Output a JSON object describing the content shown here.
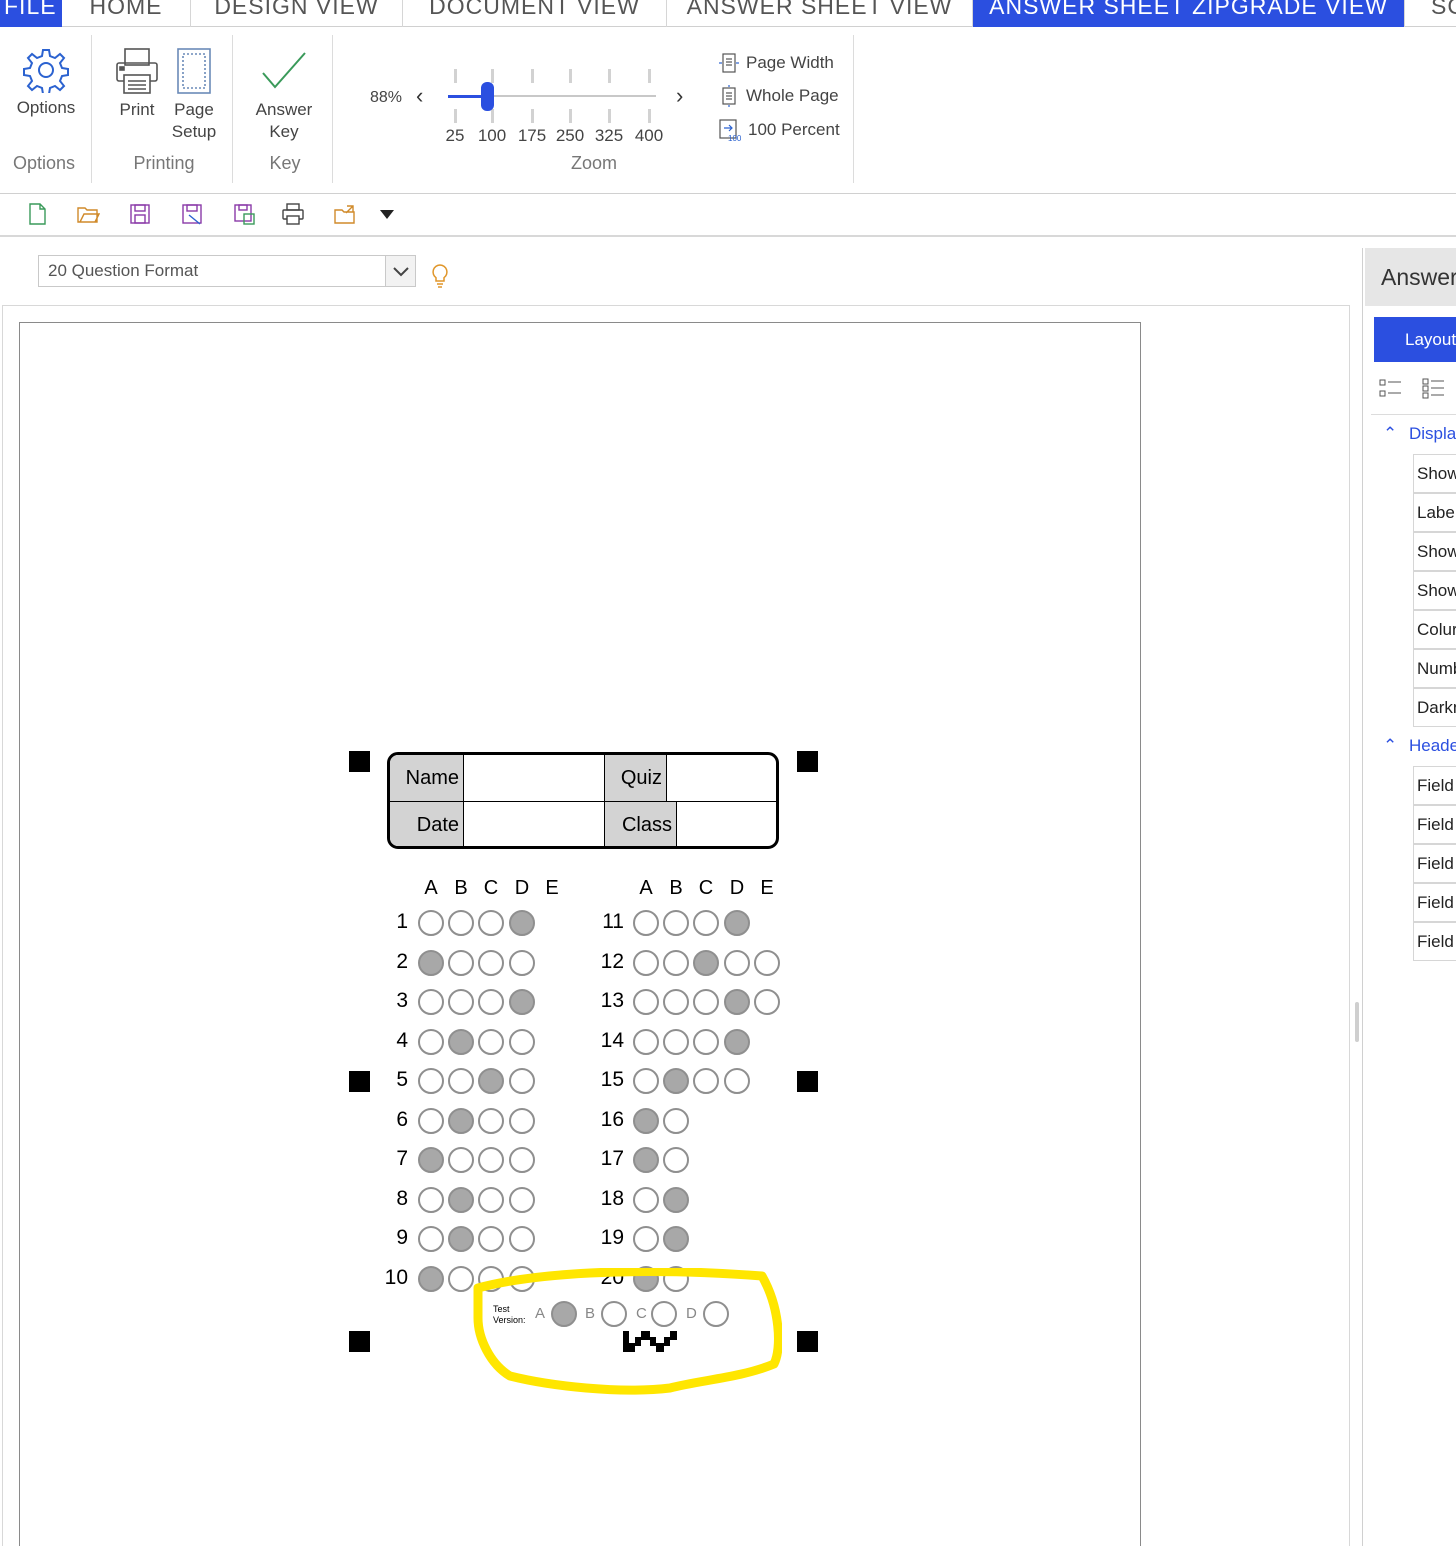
{
  "tabs": [
    {
      "label": "FILE",
      "active": false
    },
    {
      "label": "HOME",
      "active": false
    },
    {
      "label": "DESIGN VIEW",
      "active": false
    },
    {
      "label": "DOCUMENT VIEW",
      "active": false
    },
    {
      "label": "ANSWER SHEET VIEW",
      "active": false
    },
    {
      "label": "ANSWER SHEET ZIPGRADE VIEW",
      "active": true
    },
    {
      "label": "SC",
      "active": false
    }
  ],
  "ribbon": {
    "options_button": "Options",
    "options_group": "Options",
    "print_button": "Print",
    "page_setup_line1": "Page",
    "page_setup_line2": "Setup",
    "printing_group": "Printing",
    "answer_key_line1": "Answer",
    "answer_key_line2": "Key",
    "key_group": "Key",
    "zoom_group": "Zoom",
    "zoom_percent": "88%",
    "zoom_level": 88,
    "zoom_ticks": [
      "25",
      "100",
      "175",
      "250",
      "325",
      "400"
    ],
    "page_width": "Page Width",
    "whole_page": "Whole Page",
    "hundred_percent": "100 Percent",
    "hundred_icon_text": "100"
  },
  "format_select": {
    "value": "20 Question Format"
  },
  "sheet": {
    "header": {
      "name": "Name",
      "quiz": "Quiz",
      "date": "Date",
      "class": "Class"
    },
    "columns": [
      "A",
      "B",
      "C",
      "D",
      "E"
    ],
    "questions": [
      {
        "num": "1",
        "count": 4,
        "filled": 3
      },
      {
        "num": "2",
        "count": 4,
        "filled": 0
      },
      {
        "num": "3",
        "count": 4,
        "filled": 3
      },
      {
        "num": "4",
        "count": 4,
        "filled": 1
      },
      {
        "num": "5",
        "count": 4,
        "filled": 2
      },
      {
        "num": "6",
        "count": 4,
        "filled": 1
      },
      {
        "num": "7",
        "count": 4,
        "filled": 0
      },
      {
        "num": "8",
        "count": 4,
        "filled": 1
      },
      {
        "num": "9",
        "count": 4,
        "filled": 1
      },
      {
        "num": "10",
        "count": 4,
        "filled": 0
      },
      {
        "num": "11",
        "count": 4,
        "filled": 3
      },
      {
        "num": "12",
        "count": 5,
        "filled": 2
      },
      {
        "num": "13",
        "count": 5,
        "filled": 3
      },
      {
        "num": "14",
        "count": 4,
        "filled": 3
      },
      {
        "num": "15",
        "count": 4,
        "filled": 1
      },
      {
        "num": "16",
        "count": 2,
        "filled": 0
      },
      {
        "num": "17",
        "count": 2,
        "filled": 0
      },
      {
        "num": "18",
        "count": 2,
        "filled": 1
      },
      {
        "num": "19",
        "count": 2,
        "filled": 1
      },
      {
        "num": "20",
        "count": 2,
        "filled": 0
      }
    ],
    "test_version": {
      "label_line1": "Test",
      "label_line2": "Version:",
      "options": [
        "A",
        "B",
        "C",
        "D"
      ],
      "filled": 0
    },
    "highlight_color": "#ffe600",
    "bubble_fill_color": "#a8a8a8"
  },
  "right_panel": {
    "title": "Answer",
    "layout_button": "Layout",
    "display_section": "Displa",
    "display_rows": [
      "Show",
      "Label",
      "Show",
      "Show",
      "Colur",
      "Numb",
      "Darkn"
    ],
    "header_section": "Heade",
    "header_rows": [
      "Field",
      "Field",
      "Field",
      "Field",
      "Field"
    ]
  },
  "colors": {
    "accent": "#2b4fe0",
    "icon_green": "#3a9a5a",
    "icon_purple": "#8a3aa8"
  }
}
